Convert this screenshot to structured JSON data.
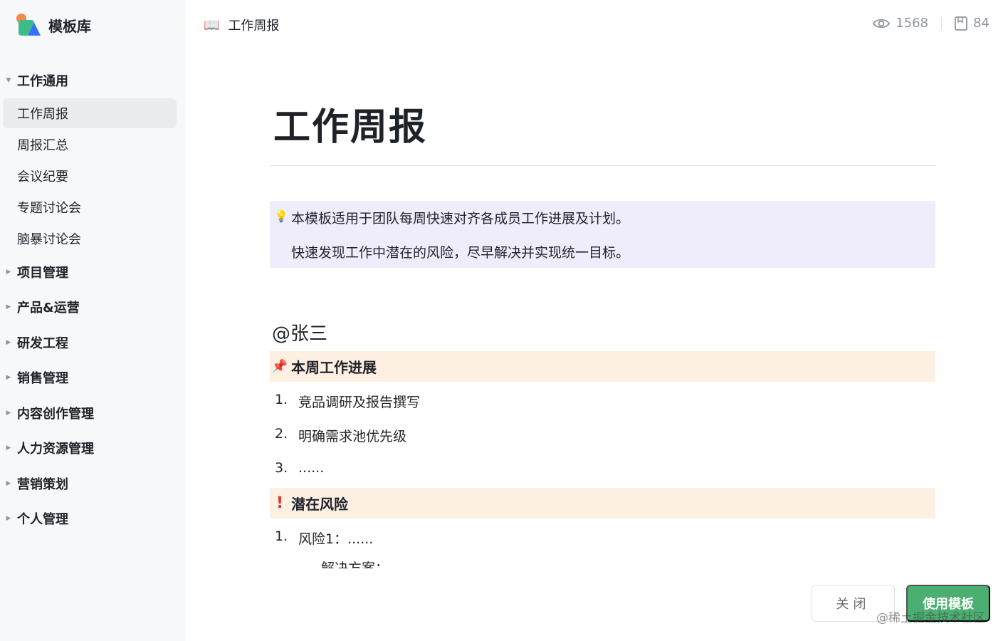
{
  "brand": {
    "name": "模板库",
    "logo_icon": "template-library-logo"
  },
  "sidebar": {
    "groups": [
      {
        "label": "工作通用",
        "expanded": true,
        "items": [
          "工作周报",
          "周报汇总",
          "会议纪要",
          "专题讨论会",
          "脑暴讨论会"
        ]
      },
      {
        "label": "项目管理",
        "expanded": false
      },
      {
        "label": "产品&运营",
        "expanded": false
      },
      {
        "label": "研发工程",
        "expanded": false
      },
      {
        "label": "销售管理",
        "expanded": false
      },
      {
        "label": "内容创作管理",
        "expanded": false
      },
      {
        "label": "人力资源管理",
        "expanded": false
      },
      {
        "label": "营销策划",
        "expanded": false
      },
      {
        "label": "个人管理",
        "expanded": false
      }
    ],
    "active_item": "工作周报"
  },
  "header": {
    "book_icon": "📖",
    "title": "工作周报",
    "views": "1568",
    "uses": "84"
  },
  "document": {
    "title": "工作周报",
    "callout": {
      "icon": "💡",
      "line1": "本模板适用于团队每周快速对齐各成员工作进展及计划。",
      "line2": "快速发现工作中潜在的风险，尽早解决并实现统一目标。"
    },
    "mention": "@张三",
    "progress_section": {
      "icon": "📌",
      "label": "本周工作进展",
      "items": [
        {
          "num": "1.",
          "text": "竞品调研及报告撰写"
        },
        {
          "num": "2.",
          "text": "明确需求池优先级"
        },
        {
          "num": "3.",
          "text": "......"
        }
      ]
    },
    "risk_section": {
      "icon": "!",
      "label": "潜在风险",
      "items": [
        {
          "num": "1.",
          "text": "风险1：......"
        }
      ],
      "cut_text": "解决方案："
    }
  },
  "footer": {
    "close_label": "关闭",
    "use_label": "使用模板",
    "watermark": "@稀土掘金技术社区"
  },
  "colors": {
    "sidebar_bg": "#f7f8fa",
    "callout_bg": "#efecfb",
    "section_bg": "#fdf0e3",
    "primary": "#4caf72"
  }
}
